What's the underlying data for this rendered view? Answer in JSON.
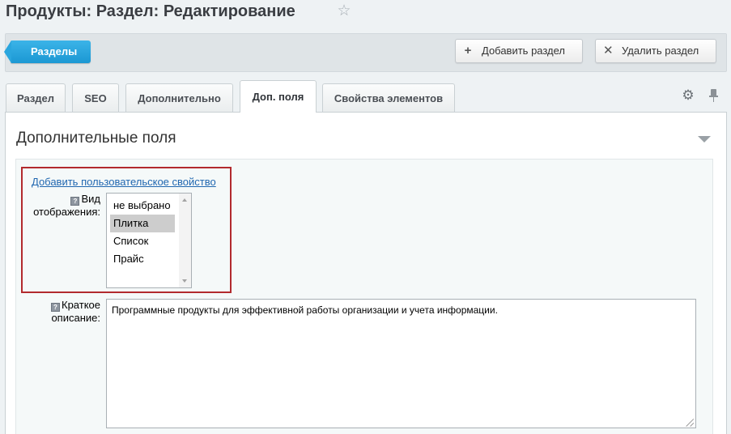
{
  "header": {
    "title": "Продукты: Раздел: Редактирование",
    "favorite_icon": "star-icon"
  },
  "toolbar": {
    "back_label": "Разделы",
    "add_label": "Добавить раздел",
    "add_icon": "plus-icon",
    "delete_label": "Удалить раздел",
    "delete_icon": "close-icon"
  },
  "tabs": [
    {
      "label": "Раздел",
      "active": false
    },
    {
      "label": "SEO",
      "active": false
    },
    {
      "label": "Дополнительно",
      "active": false
    },
    {
      "label": "Доп. поля",
      "active": true
    },
    {
      "label": "Свойства элементов",
      "active": false
    }
  ],
  "tab_tools": {
    "settings_icon": "gear-icon",
    "pin_icon": "pin-icon"
  },
  "section": {
    "title": "Дополнительные поля",
    "add_property_link": "Добавить пользовательское свойство",
    "fields": {
      "view": {
        "label": "Вид отображения:",
        "options": [
          "не выбрано",
          "Плитка",
          "Список",
          "Прайс"
        ],
        "selected": "Плитка"
      },
      "description": {
        "label": "Краткое описание:",
        "value": "Программные продукты для эффективной работы организации и учета информации."
      }
    }
  },
  "colors": {
    "accent": "#1b98d3",
    "highlight_border": "#b22a2e",
    "link": "#2067b0"
  }
}
